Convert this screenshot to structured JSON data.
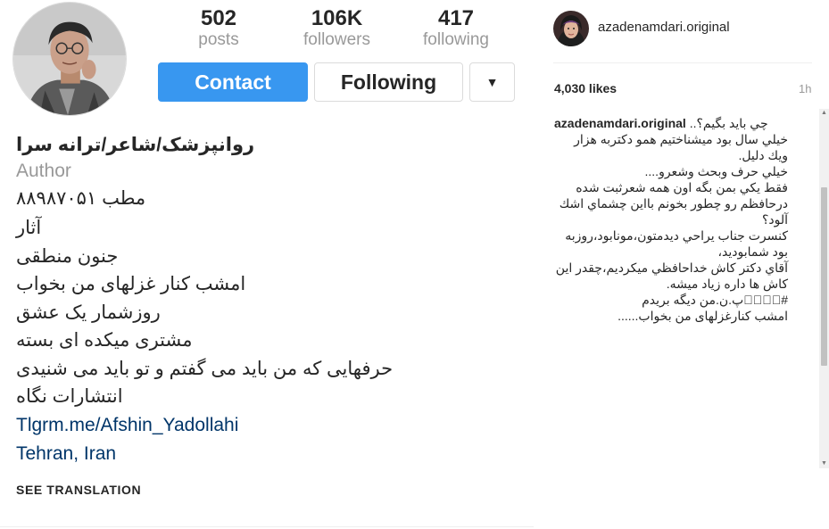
{
  "profile": {
    "stats": {
      "posts": {
        "value": "502",
        "label": "posts"
      },
      "followers": {
        "value": "106K",
        "label": "followers"
      },
      "following": {
        "value": "417",
        "label": "following"
      }
    },
    "buttons": {
      "contact": "Contact",
      "following": "Following",
      "dropdown": "▼"
    },
    "bio": {
      "name": "روانپزشک/شاعر/ترانه سرا",
      "category": "Author",
      "lines": [
        "مطب ۸۸۹۸۷۰۵۱",
        "آثار",
        "جنون منطقی",
        "امشب کنار غزلهای من بخواب",
        "روزشمار یک عشق",
        "مشتری میکده ای بسته",
        "حرفهایی که من باید می گفتم و تو باید می شنیدی",
        "انتشارات نگاه"
      ],
      "link": "Tlgrm.me/Afshin_Yadollahi",
      "location": "Tehran, Iran"
    },
    "see_translation": "SEE TRANSLATION"
  },
  "post": {
    "username": "azadenamdari.original",
    "likes": "4,030 likes",
    "time_ago": "1h",
    "caption": {
      "user": "azadenamdari.original",
      "first_line": "چي بايد بگيم؟..",
      "lines": [
        "خيلي سال بود ميشناختيم همو دكتربه هزار",
        "ويك دليل.",
        "خيلي حرف وبحث وشعرو....",
        "فقط يكي بمن بگه اون همه شعرثبت شده",
        "درحافظم رو چطور بخونم بااين چشماي اشك",
        "آلود؟",
        "كنسرت جناب يراحي ديدمتون،مونابود،روزبه",
        "بود شمابوديد،",
        "آقاي دكتر كاش خداحافظي ميكرديم،چقدر اين",
        "كاش ها داره زياد ميشه.",
        "#🏻🏻🏻🏻پ.ن.من ديگه بريدم",
        "امشب كنارغزلهاى من بخواب......"
      ]
    }
  },
  "colors": {
    "accent": "#3897f0",
    "link": "#003569",
    "muted": "#999999",
    "text": "#262626",
    "border": "#dbdbdb"
  },
  "icons": {
    "dropdown": "caret-down-icon",
    "scroll_up": "scroll-up-arrow-icon",
    "scroll_down": "scroll-down-arrow-icon"
  }
}
